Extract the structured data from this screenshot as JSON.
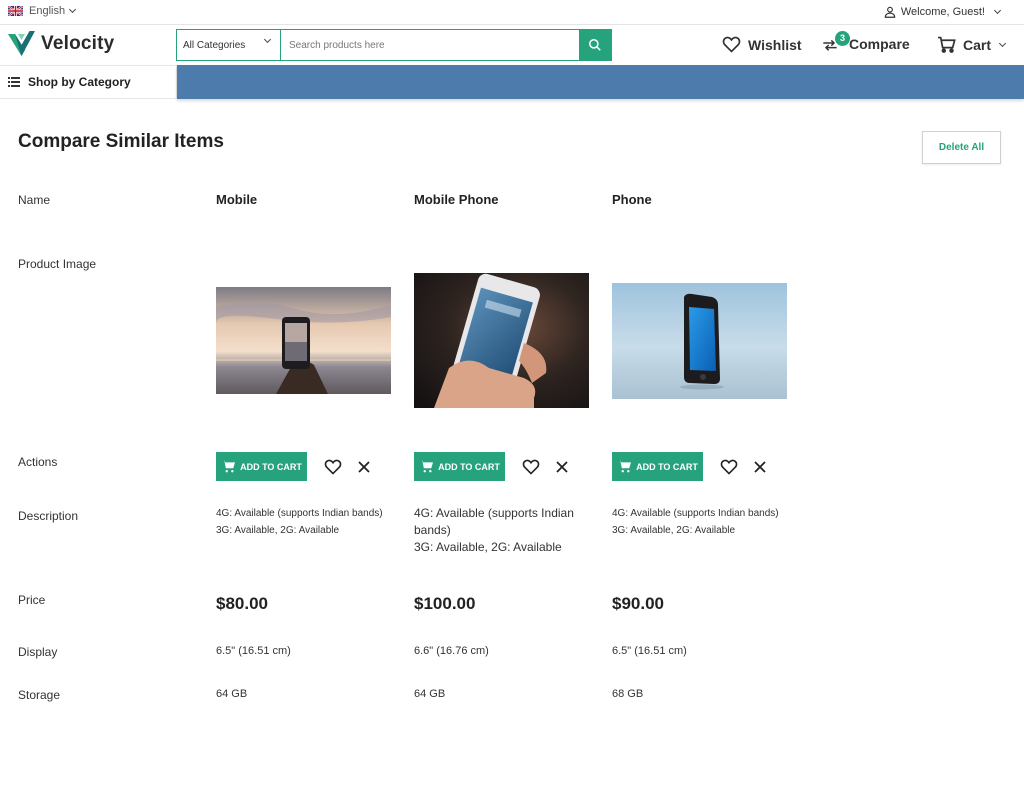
{
  "topbar": {
    "language": "English",
    "welcome": "Welcome, Guest!"
  },
  "header": {
    "logo_text": "Velocity",
    "category_select": "All Categories",
    "search_placeholder": "Search products here",
    "wishlist_label": "Wishlist",
    "compare_label": "Compare",
    "compare_count": "3",
    "cart_label": "Cart"
  },
  "nav": {
    "shop_by_category": "Shop by Category"
  },
  "compare": {
    "title": "Compare Similar Items",
    "delete_all": "Delete All",
    "row_labels": {
      "name": "Name",
      "image": "Product Image",
      "actions": "Actions",
      "description": "Description",
      "price": "Price",
      "display": "Display",
      "storage": "Storage"
    },
    "add_to_cart_label": "ADD TO CART",
    "products": [
      {
        "name": "Mobile",
        "desc_line1": "4G: Available (supports Indian bands)",
        "desc_line2": "3G: Available, 2G: Available",
        "price": "$80.00",
        "display": "6.5\" (16.51 cm)",
        "storage": "64 GB"
      },
      {
        "name": "Mobile Phone",
        "desc_line1": "4G: Available (supports Indian",
        "desc_line1b": "bands)",
        "desc_line2": "3G: Available, 2G: Available",
        "price": "$100.00",
        "display": "6.6\" (16.76 cm)",
        "storage": "64 GB"
      },
      {
        "name": "Phone",
        "desc_line1": "4G: Available (supports Indian bands)",
        "desc_line2": "3G: Available, 2G: Available",
        "price": "$90.00",
        "display": "6.5\" (16.51 cm)",
        "storage": "68 GB"
      }
    ]
  },
  "colors": {
    "accent": "#26a37c",
    "nav_bar": "#4d7cac"
  },
  "icons": [
    "uk-flag-icon",
    "user-icon",
    "velocity-logo-icon",
    "search-icon",
    "heart-icon",
    "compare-arrows-icon",
    "cart-icon",
    "menu-icon",
    "close-icon"
  ]
}
